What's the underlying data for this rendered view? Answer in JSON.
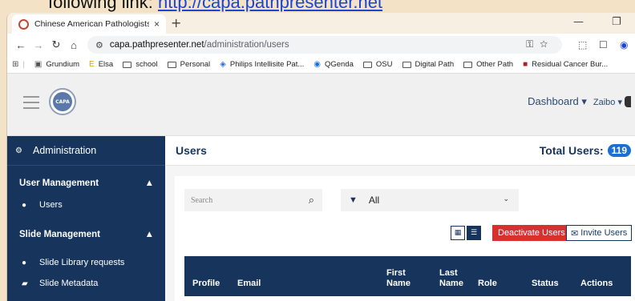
{
  "caption": {
    "prefix": "following link: ",
    "link": "http://capa.pathpresenter.net"
  },
  "browser": {
    "tab_title": "Chinese American Pathologists",
    "tab_close": "×",
    "new_tab": "+",
    "url_host": "capa.pathpresenter.net",
    "url_path": "/administration/users",
    "bookmarks": [
      {
        "label": "Grundium",
        "icon": "grundium-icon"
      },
      {
        "label": "Elsa",
        "icon": "elsa-icon"
      },
      {
        "label": "school",
        "icon": "folder-icon"
      },
      {
        "label": "Personal",
        "icon": "folder-icon"
      },
      {
        "label": "Philips Intellisite Pat...",
        "icon": "philips-icon"
      },
      {
        "label": "QGenda",
        "icon": "qgenda-icon"
      },
      {
        "label": "OSU",
        "icon": "folder-icon"
      },
      {
        "label": "Digital Path",
        "icon": "folder-icon"
      },
      {
        "label": "Other Path",
        "icon": "folder-icon"
      },
      {
        "label": "Residual Cancer Bur...",
        "icon": "rcb-icon"
      }
    ]
  },
  "header": {
    "logo_text": "CAPA",
    "dashboard": "Dashboard ▾",
    "user": "Zaibo ▾"
  },
  "sidebar": {
    "title": "Administration",
    "sections": [
      {
        "label": "User Management",
        "items": [
          {
            "label": "Users"
          }
        ]
      },
      {
        "label": "Slide Management",
        "items": [
          {
            "label": "Slide Library requests"
          },
          {
            "label": "Slide Metadata"
          }
        ]
      }
    ]
  },
  "main": {
    "title": "Users",
    "total_label": "Total Users:",
    "total_count": "119",
    "search_placeholder": "Search",
    "filter_value": "All",
    "deactivate_label": "Deactivate Users",
    "invite_label": "Invite Users",
    "columns": [
      "Profile",
      "Email",
      "First Name",
      "Last Name",
      "Role",
      "Status",
      "Actions"
    ]
  },
  "colors": {
    "navy": "#17355c",
    "danger": "#d63031",
    "badge": "#1a6fd6"
  }
}
